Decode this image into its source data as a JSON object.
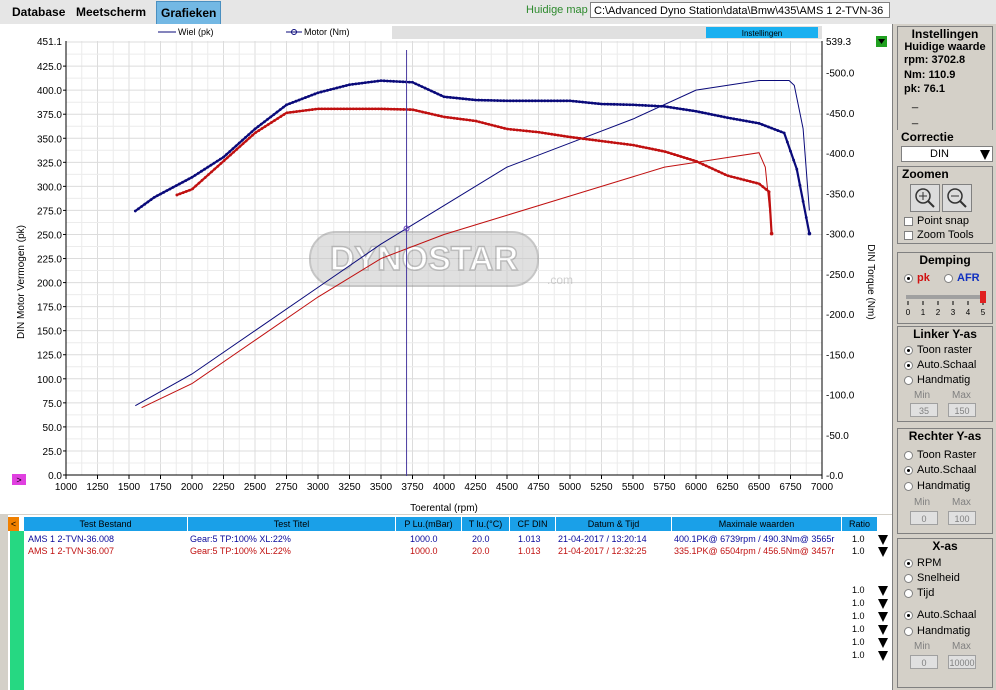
{
  "menu": {
    "database": "Database",
    "meetscherm": "Meetscherm",
    "grafieken": "Grafieken"
  },
  "huidige_map": {
    "label": "Huidige map",
    "value": "C:\\Advanced Dyno Station\\data\\Bmw\\435\\AMS 1  2-TVN-36"
  },
  "chart": {
    "legend_wiel": "Wiel (pk)",
    "legend_motor": "Motor (Nm)",
    "settings_btn": "Instellingen",
    "left_axis_label": "DIN Motor Vermogen (pk)",
    "right_axis_label": "DIN Torque (Nm)",
    "x_axis_label": "Toerental (rpm)",
    "watermark": "DYNOSTAR",
    "watermark_com": ".com",
    "left_top": "451.1",
    "right_top": "539.3",
    "left_ticks": [
      "425.0",
      "400.0",
      "375.0",
      "350.0",
      "325.0",
      "300.0",
      "275.0",
      "250.0",
      "225.0",
      "200.0",
      "175.0",
      "150.0",
      "125.0",
      "100.0",
      "75.0",
      "50.0",
      "25.0",
      "0.0"
    ],
    "right_ticks": [
      "500.0",
      "450.0",
      "400.0",
      "350.0",
      "300.0",
      "250.0",
      "200.0",
      "150.0",
      "100.0",
      "50.0",
      "0.0"
    ],
    "x_ticks": [
      "1000",
      "1250",
      "1500",
      "1750",
      "2000",
      "2250",
      "2500",
      "2750",
      "3000",
      "3250",
      "3500",
      "3750",
      "4000",
      "4250",
      "4500",
      "4750",
      "5000",
      "5250",
      "5500",
      "5750",
      "6000",
      "6250",
      "6500",
      "6750",
      "7000"
    ],
    "cursor_rpm": 3702.8
  },
  "chart_data": {
    "type": "line",
    "xlabel": "Toerental (rpm)",
    "ylabel": "DIN Motor Vermogen (pk)",
    "y2label": "DIN Torque (Nm)",
    "xlim": [
      1000,
      7000
    ],
    "ylim": [
      0,
      451.1
    ],
    "y2lim": [
      0,
      539.3
    ],
    "grid": true,
    "legend": "top",
    "series": [
      {
        "name": "Wiel (pk)",
        "test": "AMS 1 2-TVN-36.008",
        "axis": "left",
        "color": "#0a0a7a",
        "style": "thin",
        "x": [
          1550,
          2000,
          2500,
          3000,
          3500,
          4000,
          4500,
          5000,
          5500,
          6000,
          6500,
          6739,
          6780,
          6850,
          6900
        ],
        "y": [
          72,
          105,
          150,
          195,
          240,
          280,
          320,
          345,
          370,
          400,
          410,
          410,
          405,
          360,
          275
        ]
      },
      {
        "name": "Motor (Nm)",
        "test": "AMS 1 2-TVN-36.008",
        "axis": "right",
        "color": "#0a0a7a",
        "style": "dotted",
        "x": [
          1550,
          1700,
          2000,
          2250,
          2500,
          2750,
          3000,
          3250,
          3500,
          3750,
          4000,
          4250,
          4500,
          4750,
          5000,
          5250,
          5500,
          5750,
          6000,
          6250,
          6500,
          6700,
          6800,
          6900
        ],
        "y": [
          328,
          345,
          370,
          395,
          430,
          460,
          475,
          485,
          490,
          488,
          470,
          466,
          465,
          465,
          465,
          461,
          460,
          458,
          452,
          444,
          437,
          425,
          380,
          300
        ]
      },
      {
        "name": "Wiel (pk)",
        "test": "AMS 1 2-TVN-36.007",
        "axis": "left",
        "color": "#c01010",
        "style": "thin",
        "x": [
          1600,
          2000,
          2500,
          3000,
          3500,
          4000,
          4500,
          5000,
          5500,
          5750,
          6000,
          6250,
          6500,
          6550,
          6600
        ],
        "y": [
          70,
          95,
          140,
          185,
          225,
          250,
          270,
          290,
          310,
          320,
          325,
          330,
          335,
          320,
          255
        ]
      },
      {
        "name": "Motor (Nm)",
        "test": "AMS 1 2-TVN-36.007",
        "axis": "right",
        "color": "#c01010",
        "style": "dotted",
        "x": [
          1880,
          2000,
          2250,
          2500,
          2750,
          3000,
          3250,
          3500,
          3750,
          4000,
          4250,
          4500,
          4750,
          5000,
          5250,
          5500,
          5750,
          6000,
          6250,
          6500,
          6580,
          6600
        ],
        "y": [
          348,
          355,
          390,
          425,
          450,
          455,
          455,
          455,
          454,
          445,
          440,
          430,
          426,
          420,
          415,
          410,
          402,
          390,
          372,
          362,
          352,
          300
        ]
      }
    ],
    "cursor": {
      "rpm": 3702.8,
      "nm": 110.9,
      "pk": 76.1
    }
  },
  "panel": {
    "instellingen": "Instellingen",
    "huidige_waarde": "Huidige waarde",
    "rpm_label": "rpm: 3702.8",
    "nm_label": "Nm: 110.9",
    "pk_label": "pk: 76.1",
    "dash": "_",
    "correctie": "Correctie",
    "correctie_value": "DIN",
    "zoomen": "Zoomen",
    "point_snap": "Point snap",
    "zoom_tools": "Zoom Tools",
    "demping": "Demping",
    "pk": "pk",
    "afr": "AFR",
    "demping_ticks": [
      "0",
      "1",
      "2",
      "3",
      "4",
      "5"
    ],
    "demping_level": 5,
    "linker": "Linker Y-as",
    "toon_raster": "Toon raster",
    "auto_schaal": "Auto.Schaal",
    "handmatig": "Handmatig",
    "min": "Min",
    "max": "Max",
    "linker_min": "35",
    "linker_max": "150",
    "rechter": "Rechter Y-as",
    "toon_raster2": "Toon Raster",
    "auto_schaal2": "Auto.Schaal",
    "handmatig2": "Handmatig",
    "rechter_min": "0",
    "rechter_max": "100",
    "xas": "X-as",
    "rpm": "RPM",
    "snelheid": "Snelheid",
    "tijd": "Tijd",
    "auto_schaal3": "Auto.Schaal",
    "handmatig3": "Handmatig",
    "x_min": "0",
    "x_max": "10000"
  },
  "table": {
    "headers": [
      "Test Bestand",
      "Test Titel",
      "P Lu.(mBar)",
      "T lu.(°C)",
      "CF DIN",
      "Datum & Tijd",
      "Maximale waarden",
      "Ratio"
    ],
    "rows": [
      {
        "file": "AMS 1  2-TVN-36.008",
        "title": "Gear:5 TP:100% XL:22%",
        "p": "1000.0",
        "t": "20.0",
        "cf": "1.013",
        "date": "21-04-2017 / 13:20:14",
        "max": "400.1PK@ 6739rpm / 490.3Nm@ 3565r",
        "ratio": "1.0",
        "color": "#0a0a9a"
      },
      {
        "file": "AMS 1  2-TVN-36.007",
        "title": "Gear:5 TP:100% XL:22%",
        "p": "1000.0",
        "t": "20.0",
        "cf": "1.013",
        "date": "21-04-2017 / 12:32:25",
        "max": "335.1PK@ 6504rpm / 456.5Nm@ 3457r",
        "ratio": "1.0",
        "color": "#c01010"
      }
    ],
    "empty_ratios": [
      "1.0",
      "1.0",
      "1.0",
      "1.0",
      "1.0",
      "1.0"
    ]
  }
}
